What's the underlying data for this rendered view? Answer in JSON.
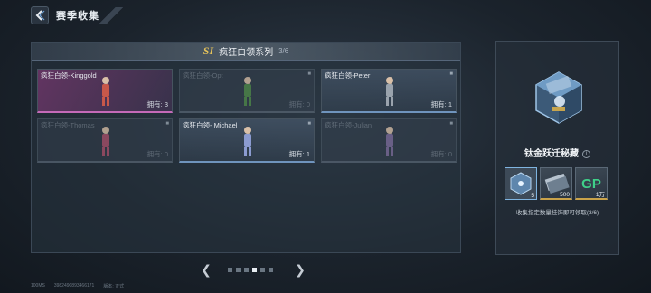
{
  "header": {
    "title": "赛季收集"
  },
  "series": {
    "badge": "SI",
    "title": "疯狂白领系列",
    "count": "3/6"
  },
  "cards": [
    {
      "name": "疯狂白领-Kinggold",
      "owned": "拥有: 3",
      "state": "owned-gold",
      "color": "#c8584a"
    },
    {
      "name": "疯狂白领-Opt",
      "owned": "拥有: 0",
      "state": "dim",
      "color": "#4f8a4a"
    },
    {
      "name": "疯狂白领-Peter",
      "owned": "拥有: 1",
      "state": "owned-blue",
      "color": "#9aa3ad"
    },
    {
      "name": "疯狂白领-Thomas",
      "owned": "拥有: 0",
      "state": "dim",
      "color": "#a8506a"
    },
    {
      "name": "疯狂白领- Michael",
      "owned": "拥有: 1",
      "state": "owned-blue",
      "color": "#8b9bd0"
    },
    {
      "name": "疯狂白领-Julian",
      "owned": "拥有: 0",
      "state": "dim",
      "color": "#7c6c9a"
    }
  ],
  "pager": {
    "total": 6,
    "active": 4
  },
  "footer": {
    "ping": "100MS",
    "id": "3982490893466171",
    "extra": "版本: 正式"
  },
  "reward": {
    "name": "钛金跃迁秘藏",
    "info_icon": "i",
    "items": [
      {
        "icon": "cube-icon",
        "qty": "5"
      },
      {
        "icon": "ticket-icon",
        "qty": "500"
      },
      {
        "icon": "gp-icon",
        "label": "GP",
        "qty": "1万"
      }
    ],
    "hint": "收集指定数量挂饰即可领取(3/6)"
  }
}
